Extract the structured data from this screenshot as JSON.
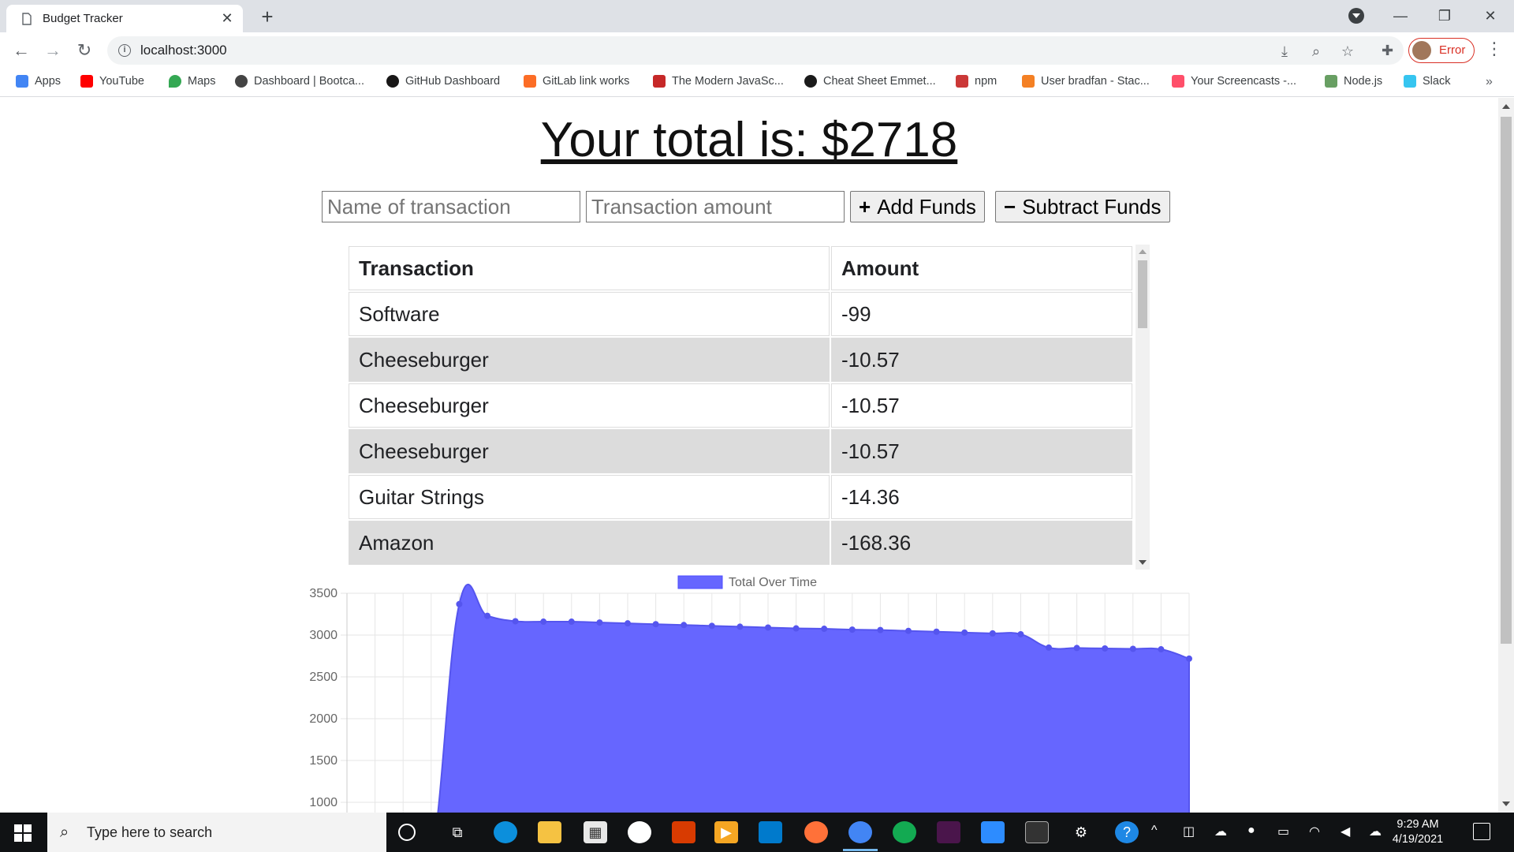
{
  "browser": {
    "tab_title": "Budget Tracker",
    "tab_close": "✕",
    "new_tab": "+",
    "url": "localhost:3000",
    "profile_status": "Error",
    "minimize": "—",
    "restore": "❐",
    "close": "✕",
    "bookmarks": [
      {
        "label": "Apps",
        "color": "#4285f4"
      },
      {
        "label": "YouTube",
        "color": "#ff0000"
      },
      {
        "label": "Maps",
        "color": "#34a853"
      },
      {
        "label": "Dashboard | Bootca...",
        "color": "#444444"
      },
      {
        "label": "GitHub Dashboard",
        "color": "#181717"
      },
      {
        "label": "GitLab link works",
        "color": "#fc6d26"
      },
      {
        "label": "The Modern JavaSc...",
        "color": "#c62828"
      },
      {
        "label": "Cheat Sheet Emmet...",
        "color": "#1b1b1b"
      },
      {
        "label": "npm",
        "color": "#cb3837"
      },
      {
        "label": "User bradfan - Stac...",
        "color": "#f48024"
      },
      {
        "label": "Your Screencasts -...",
        "color": "#ff4f6a"
      },
      {
        "label": "Node.js",
        "color": "#689f63"
      },
      {
        "label": "Slack",
        "color": "#36c5f0"
      }
    ],
    "bookmarks_more": "»"
  },
  "app": {
    "total_text": "Your total is: $2718",
    "name_placeholder": "Name of transaction",
    "amount_placeholder": "Transaction amount",
    "add_label": "Add Funds",
    "subtract_label": "Subtract Funds",
    "add_icon": "+",
    "subtract_icon": "−",
    "table": {
      "headers": [
        "Transaction",
        "Amount"
      ],
      "rows": [
        [
          "Software",
          "-99"
        ],
        [
          "Cheeseburger",
          "-10.57"
        ],
        [
          "Cheeseburger",
          "-10.57"
        ],
        [
          "Cheeseburger",
          "-10.57"
        ],
        [
          "Guitar Strings",
          "-14.36"
        ],
        [
          "Amazon",
          "-168.36"
        ]
      ]
    }
  },
  "chart_data": {
    "type": "area",
    "legend": [
      "Total Over Time"
    ],
    "color": "#6666ff",
    "yticks": [
      "3500",
      "3000",
      "2500",
      "2000",
      "1500",
      "1000"
    ],
    "ylim": [
      1000,
      3500
    ],
    "series": [
      {
        "name": "Total Over Time",
        "values": [
          0,
          0,
          0,
          0,
          3370,
          3230,
          3165,
          3160,
          3160,
          3150,
          3140,
          3130,
          3120,
          3110,
          3100,
          3090,
          3080,
          3075,
          3065,
          3060,
          3050,
          3040,
          3030,
          3020,
          3010,
          2850,
          2845,
          2840,
          2835,
          2830,
          2718
        ]
      }
    ]
  },
  "taskbar": {
    "search_placeholder": "Type here to search",
    "time": "9:29 AM",
    "date": "4/19/2021"
  }
}
